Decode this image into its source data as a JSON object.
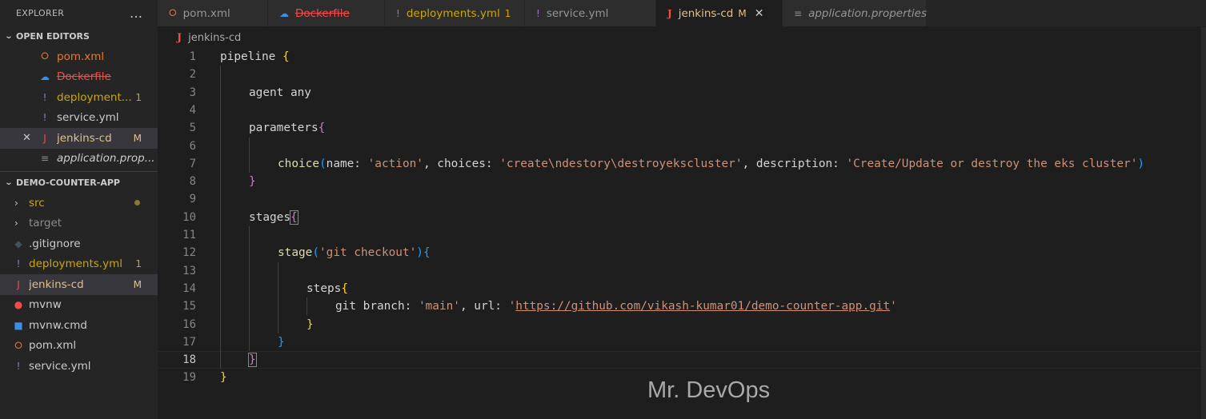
{
  "sidebar": {
    "title": "EXPLORER",
    "more_icon": "…",
    "open_editors": {
      "label": "OPEN EDITORS",
      "items": [
        {
          "name": "pom.xml",
          "icon": "rss-icon",
          "glyph": "⭘",
          "color": "#e37933",
          "badge": ""
        },
        {
          "name": "Dockerfile",
          "icon": "docker-icon",
          "glyph": "☁",
          "color": "#f14c4c",
          "badge": "",
          "deleted": true
        },
        {
          "name": "deployment...",
          "icon": "yaml-icon",
          "glyph": "!",
          "color": "#cca700",
          "badge": "1"
        },
        {
          "name": "service.yml",
          "icon": "yaml-icon",
          "glyph": "!",
          "color": "#cccccc",
          "badge": ""
        },
        {
          "name": "jenkins-cd",
          "icon": "jenkins-icon",
          "glyph": "J",
          "color": "#e2c08d",
          "badge": "M",
          "active": true
        },
        {
          "name": "application.prop...",
          "icon": "properties-icon",
          "glyph": "≡",
          "color": "#cccccc",
          "badge": "",
          "italic": true
        }
      ]
    },
    "project": {
      "label": "DEMO-COUNTER-APP",
      "items": [
        {
          "name": "src",
          "type": "folder",
          "color": "#cca700",
          "badge": "dot"
        },
        {
          "name": "target",
          "type": "folder",
          "color": "#8c8c8c",
          "badge": ""
        },
        {
          "name": ".gitignore",
          "type": "file",
          "icon": "git-icon",
          "glyph": "◆",
          "color": "#cccccc",
          "badge": ""
        },
        {
          "name": "deployments.yml",
          "type": "file",
          "icon": "yaml-icon",
          "glyph": "!",
          "color": "#cca700",
          "badge": "1"
        },
        {
          "name": "jenkins-cd",
          "type": "file",
          "icon": "jenkins-icon",
          "glyph": "J",
          "color": "#e2c08d",
          "badge": "M",
          "active": true
        },
        {
          "name": "mvnw",
          "type": "file",
          "icon": "maven-icon",
          "glyph": "●",
          "color": "#cccccc",
          "badge": ""
        },
        {
          "name": "mvnw.cmd",
          "type": "file",
          "icon": "windows-icon",
          "glyph": "■",
          "color": "#cccccc",
          "badge": ""
        },
        {
          "name": "pom.xml",
          "type": "file",
          "icon": "rss-icon",
          "glyph": "⭘",
          "color": "#cccccc",
          "badge": ""
        },
        {
          "name": "service.yml",
          "type": "file",
          "icon": "yaml-icon",
          "glyph": "!",
          "color": "#cccccc",
          "badge": ""
        }
      ]
    }
  },
  "tabs": [
    {
      "label": "pom.xml",
      "icon": "rss-icon",
      "glyph": "⭘",
      "icon_color": "#e37933",
      "color": "#969696",
      "badge": ""
    },
    {
      "label": "Dockerfile",
      "icon": "docker-icon",
      "glyph": "☁",
      "icon_color": "#3b8eea",
      "color": "#f14c4c",
      "badge": "",
      "deleted": true
    },
    {
      "label": "deployments.yml",
      "icon": "yaml-icon",
      "glyph": "!",
      "icon_color": "#a074c4",
      "color": "#cca700",
      "badge": "1"
    },
    {
      "label": "service.yml",
      "icon": "yaml-icon",
      "glyph": "!",
      "icon_color": "#a074c4",
      "color": "#969696",
      "badge": ""
    },
    {
      "label": "jenkins-cd",
      "icon": "jenkins-icon",
      "glyph": "J",
      "icon_color": "#f14c4c",
      "color": "#e2c08d",
      "badge": "M",
      "active": true,
      "close": "✕"
    },
    {
      "label": "application.properties",
      "icon": "properties-icon",
      "glyph": "≡",
      "icon_color": "#8c8c8c",
      "color": "#969696",
      "badge": "",
      "italic": true
    }
  ],
  "breadcrumb": {
    "icon": "J",
    "file": "jenkins-cd"
  },
  "editor": {
    "current_line": 18,
    "lines": [
      {
        "n": "1",
        "indent": 0,
        "tokens": [
          [
            "k",
            "pipeline "
          ],
          [
            "b1",
            "{"
          ]
        ]
      },
      {
        "n": "2",
        "indent": 0,
        "tokens": []
      },
      {
        "n": "3",
        "indent": 1,
        "tokens": [
          [
            "k",
            "agent any"
          ]
        ]
      },
      {
        "n": "4",
        "indent": 0,
        "tokens": []
      },
      {
        "n": "5",
        "indent": 1,
        "tokens": [
          [
            "k",
            "parameters"
          ],
          [
            "b2",
            "{"
          ]
        ]
      },
      {
        "n": "6",
        "indent": 0,
        "tokens": []
      },
      {
        "n": "7",
        "indent": 2,
        "tokens": [
          [
            "fn",
            "choice"
          ],
          [
            "b3",
            "("
          ],
          [
            "k",
            "name: "
          ],
          [
            "s",
            "'action'"
          ],
          [
            "k",
            ", choices: "
          ],
          [
            "s",
            "'create\\ndestory\\destroyekscluster'"
          ],
          [
            "k",
            ", description: "
          ],
          [
            "s",
            "'Create/Update or destroy the eks cluster'"
          ],
          [
            "b3",
            ")"
          ]
        ]
      },
      {
        "n": "8",
        "indent": 1,
        "tokens": [
          [
            "b2",
            "}"
          ]
        ]
      },
      {
        "n": "9",
        "indent": 0,
        "tokens": []
      },
      {
        "n": "10",
        "indent": 1,
        "tokens": [
          [
            "k",
            "stages"
          ],
          [
            "b2 bm",
            "{"
          ]
        ]
      },
      {
        "n": "11",
        "indent": 0,
        "tokens": []
      },
      {
        "n": "12",
        "indent": 2,
        "tokens": [
          [
            "fn",
            "stage"
          ],
          [
            "b3",
            "("
          ],
          [
            "s",
            "'git checkout'"
          ],
          [
            "b3",
            ")"
          ],
          [
            "b3",
            "{"
          ]
        ]
      },
      {
        "n": "13",
        "indent": 0,
        "tokens": []
      },
      {
        "n": "14",
        "indent": 3,
        "tokens": [
          [
            "k",
            "steps"
          ],
          [
            "b1",
            "{"
          ]
        ]
      },
      {
        "n": "15",
        "indent": 4,
        "tokens": [
          [
            "k",
            "git branch: "
          ],
          [
            "s",
            "'main'"
          ],
          [
            "k",
            ", url: "
          ],
          [
            "s",
            "'"
          ],
          [
            "s url",
            "https://github.com/vikash-kumar01/demo-counter-app.git"
          ],
          [
            "s",
            "'"
          ]
        ]
      },
      {
        "n": "16",
        "indent": 3,
        "tokens": [
          [
            "b1",
            "}"
          ]
        ]
      },
      {
        "n": "17",
        "indent": 2,
        "tokens": [
          [
            "b3",
            "}"
          ]
        ]
      },
      {
        "n": "18",
        "indent": 1,
        "tokens": [
          [
            "b2 bm",
            "}"
          ]
        ]
      },
      {
        "n": "19",
        "indent": 0,
        "tokens": [
          [
            "b1",
            "}"
          ]
        ]
      }
    ]
  },
  "watermark": "Mr. DevOps"
}
